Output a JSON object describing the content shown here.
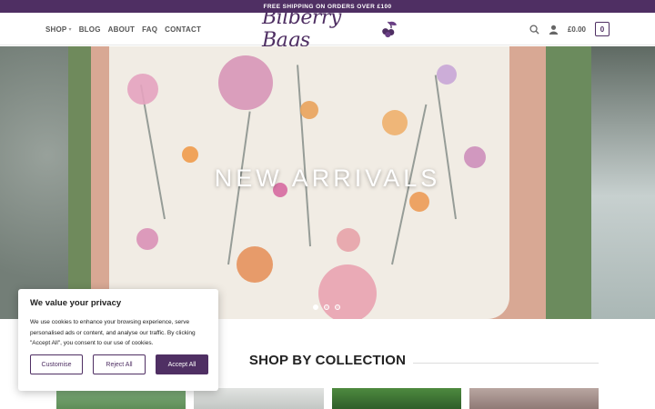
{
  "topbar": {
    "text": "FREE SHIPPING ON ORDERS OVER £100"
  },
  "nav": {
    "shop": "SHOP",
    "blog": "BLOG",
    "about": "ABOUT",
    "faq": "FAQ",
    "contact": "CONTACT"
  },
  "logo": {
    "text": "Bilberry Bags"
  },
  "header": {
    "cart_amount": "£0.00",
    "cart_count": "0"
  },
  "hero": {
    "title": "NEW ARRIVALS",
    "slide_count": 3,
    "active_slide": 1
  },
  "section": {
    "title": "SHOP BY COLLECTION"
  },
  "cookie": {
    "title": "We value your privacy",
    "text": "We use cookies to enhance your browsing experience, serve personalised ads or content, and analyse our traffic. By clicking \"Accept All\", you consent to our use of cookies.",
    "customise": "Customise",
    "reject": "Reject All",
    "accept": "Accept All"
  },
  "colors": {
    "brand": "#4f2f63",
    "topbar_bg": "#4f2f63"
  },
  "icons": {
    "search": "search-icon",
    "account": "user-icon",
    "cart": "cart-icon",
    "caret": "chevron-down-icon"
  }
}
